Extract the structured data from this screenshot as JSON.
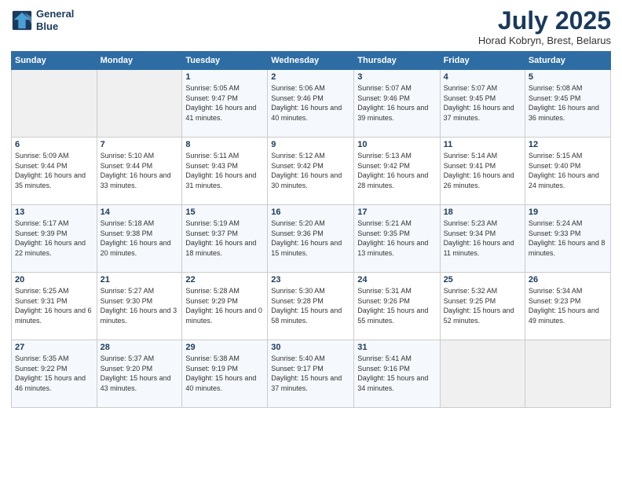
{
  "logo": {
    "line1": "General",
    "line2": "Blue"
  },
  "title": "July 2025",
  "subtitle": "Horad Kobryn, Brest, Belarus",
  "headers": [
    "Sunday",
    "Monday",
    "Tuesday",
    "Wednesday",
    "Thursday",
    "Friday",
    "Saturday"
  ],
  "weeks": [
    [
      {
        "day": "",
        "info": ""
      },
      {
        "day": "",
        "info": ""
      },
      {
        "day": "1",
        "info": "Sunrise: 5:05 AM\nSunset: 9:47 PM\nDaylight: 16 hours and 41 minutes."
      },
      {
        "day": "2",
        "info": "Sunrise: 5:06 AM\nSunset: 9:46 PM\nDaylight: 16 hours and 40 minutes."
      },
      {
        "day": "3",
        "info": "Sunrise: 5:07 AM\nSunset: 9:46 PM\nDaylight: 16 hours and 39 minutes."
      },
      {
        "day": "4",
        "info": "Sunrise: 5:07 AM\nSunset: 9:45 PM\nDaylight: 16 hours and 37 minutes."
      },
      {
        "day": "5",
        "info": "Sunrise: 5:08 AM\nSunset: 9:45 PM\nDaylight: 16 hours and 36 minutes."
      }
    ],
    [
      {
        "day": "6",
        "info": "Sunrise: 5:09 AM\nSunset: 9:44 PM\nDaylight: 16 hours and 35 minutes."
      },
      {
        "day": "7",
        "info": "Sunrise: 5:10 AM\nSunset: 9:44 PM\nDaylight: 16 hours and 33 minutes."
      },
      {
        "day": "8",
        "info": "Sunrise: 5:11 AM\nSunset: 9:43 PM\nDaylight: 16 hours and 31 minutes."
      },
      {
        "day": "9",
        "info": "Sunrise: 5:12 AM\nSunset: 9:42 PM\nDaylight: 16 hours and 30 minutes."
      },
      {
        "day": "10",
        "info": "Sunrise: 5:13 AM\nSunset: 9:42 PM\nDaylight: 16 hours and 28 minutes."
      },
      {
        "day": "11",
        "info": "Sunrise: 5:14 AM\nSunset: 9:41 PM\nDaylight: 16 hours and 26 minutes."
      },
      {
        "day": "12",
        "info": "Sunrise: 5:15 AM\nSunset: 9:40 PM\nDaylight: 16 hours and 24 minutes."
      }
    ],
    [
      {
        "day": "13",
        "info": "Sunrise: 5:17 AM\nSunset: 9:39 PM\nDaylight: 16 hours and 22 minutes."
      },
      {
        "day": "14",
        "info": "Sunrise: 5:18 AM\nSunset: 9:38 PM\nDaylight: 16 hours and 20 minutes."
      },
      {
        "day": "15",
        "info": "Sunrise: 5:19 AM\nSunset: 9:37 PM\nDaylight: 16 hours and 18 minutes."
      },
      {
        "day": "16",
        "info": "Sunrise: 5:20 AM\nSunset: 9:36 PM\nDaylight: 16 hours and 15 minutes."
      },
      {
        "day": "17",
        "info": "Sunrise: 5:21 AM\nSunset: 9:35 PM\nDaylight: 16 hours and 13 minutes."
      },
      {
        "day": "18",
        "info": "Sunrise: 5:23 AM\nSunset: 9:34 PM\nDaylight: 16 hours and 11 minutes."
      },
      {
        "day": "19",
        "info": "Sunrise: 5:24 AM\nSunset: 9:33 PM\nDaylight: 16 hours and 8 minutes."
      }
    ],
    [
      {
        "day": "20",
        "info": "Sunrise: 5:25 AM\nSunset: 9:31 PM\nDaylight: 16 hours and 6 minutes."
      },
      {
        "day": "21",
        "info": "Sunrise: 5:27 AM\nSunset: 9:30 PM\nDaylight: 16 hours and 3 minutes."
      },
      {
        "day": "22",
        "info": "Sunrise: 5:28 AM\nSunset: 9:29 PM\nDaylight: 16 hours and 0 minutes."
      },
      {
        "day": "23",
        "info": "Sunrise: 5:30 AM\nSunset: 9:28 PM\nDaylight: 15 hours and 58 minutes."
      },
      {
        "day": "24",
        "info": "Sunrise: 5:31 AM\nSunset: 9:26 PM\nDaylight: 15 hours and 55 minutes."
      },
      {
        "day": "25",
        "info": "Sunrise: 5:32 AM\nSunset: 9:25 PM\nDaylight: 15 hours and 52 minutes."
      },
      {
        "day": "26",
        "info": "Sunrise: 5:34 AM\nSunset: 9:23 PM\nDaylight: 15 hours and 49 minutes."
      }
    ],
    [
      {
        "day": "27",
        "info": "Sunrise: 5:35 AM\nSunset: 9:22 PM\nDaylight: 15 hours and 46 minutes."
      },
      {
        "day": "28",
        "info": "Sunrise: 5:37 AM\nSunset: 9:20 PM\nDaylight: 15 hours and 43 minutes."
      },
      {
        "day": "29",
        "info": "Sunrise: 5:38 AM\nSunset: 9:19 PM\nDaylight: 15 hours and 40 minutes."
      },
      {
        "day": "30",
        "info": "Sunrise: 5:40 AM\nSunset: 9:17 PM\nDaylight: 15 hours and 37 minutes."
      },
      {
        "day": "31",
        "info": "Sunrise: 5:41 AM\nSunset: 9:16 PM\nDaylight: 15 hours and 34 minutes."
      },
      {
        "day": "",
        "info": ""
      },
      {
        "day": "",
        "info": ""
      }
    ]
  ]
}
